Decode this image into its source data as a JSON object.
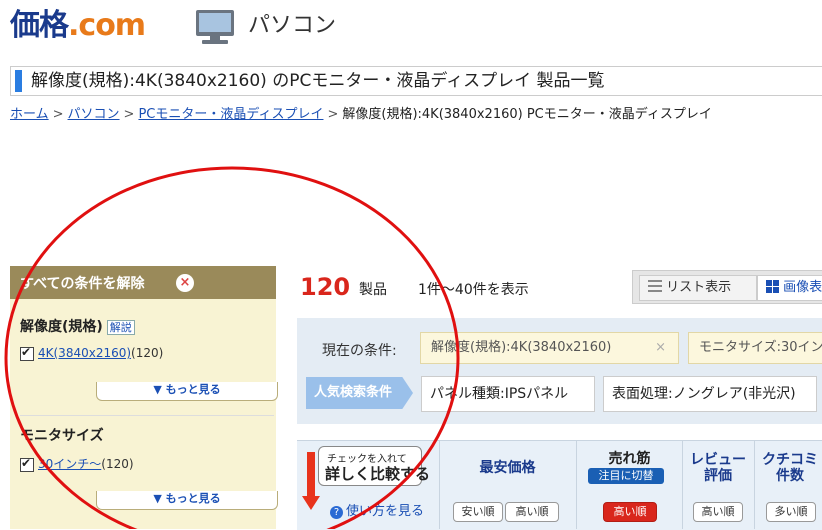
{
  "header": {
    "logo_main": "価格",
    "logo_dot": ".",
    "logo_com": "com",
    "category": "パソコン",
    "category_icon": "pc-monitor-icon"
  },
  "title": "解像度(規格):4K(3840x2160) のPCモニター・液晶ディスプレイ 製品一覧",
  "breadcrumb": {
    "items": [
      "ホーム",
      "パソコン",
      "PCモニター・液晶ディスプレイ"
    ],
    "separator": ">",
    "current": "解像度(規格):4K(3840x2160) PCモニター・液晶ディスプレイ"
  },
  "filters": {
    "clear_all": "すべての条件を解除",
    "resolution": {
      "title": "解像度(規格)",
      "help": "解説",
      "item_label": "4K(3840x2160)",
      "item_count": "(120)",
      "more": "▼ もっと見る"
    },
    "size": {
      "title": "モニタサイズ",
      "item_label": "30インチ～",
      "item_count": "(120)",
      "more": "▼ もっと見る"
    }
  },
  "results": {
    "count": "120",
    "count_unit": "製品",
    "range": "1件～40件を表示",
    "view_list": "リスト表示",
    "view_image": "画像表"
  },
  "conditions": {
    "label": "現在の条件:",
    "tags": [
      "解像度(規格):4K(3840x2160)",
      "モニタサイズ:30イン"
    ],
    "remove_icon": "×",
    "popular_label": "人気検索条件",
    "popular_tags": [
      "パネル種類:IPSパネル",
      "表面処理:ノングレア(非光沢)"
    ]
  },
  "table_header": {
    "compare_line1": "チェックを入れて",
    "compare_line2": "詳しく比較する",
    "howto": "使い方を見る",
    "lowest_price": "最安価格",
    "best_seller": "売れ筋",
    "best_seller_badge": "注目に切替",
    "review_line1": "レビュー",
    "review_line2": "評価",
    "kuchikomi_line1": "クチコミ",
    "kuchikomi_line2": "件数",
    "sort_cheap": "安い順",
    "sort_expensive": "高い順",
    "sort_high": "高い順",
    "sort_review_high": "高い順",
    "sort_many": "多い順"
  },
  "colors": {
    "brand_blue": "#1a3a8c",
    "brand_orange": "#e87a1a",
    "accent_red": "#d9261c",
    "annotation_circle": "#e01010",
    "filter_head": "#9a8a5a",
    "filter_bg": "#f8f3d3"
  }
}
